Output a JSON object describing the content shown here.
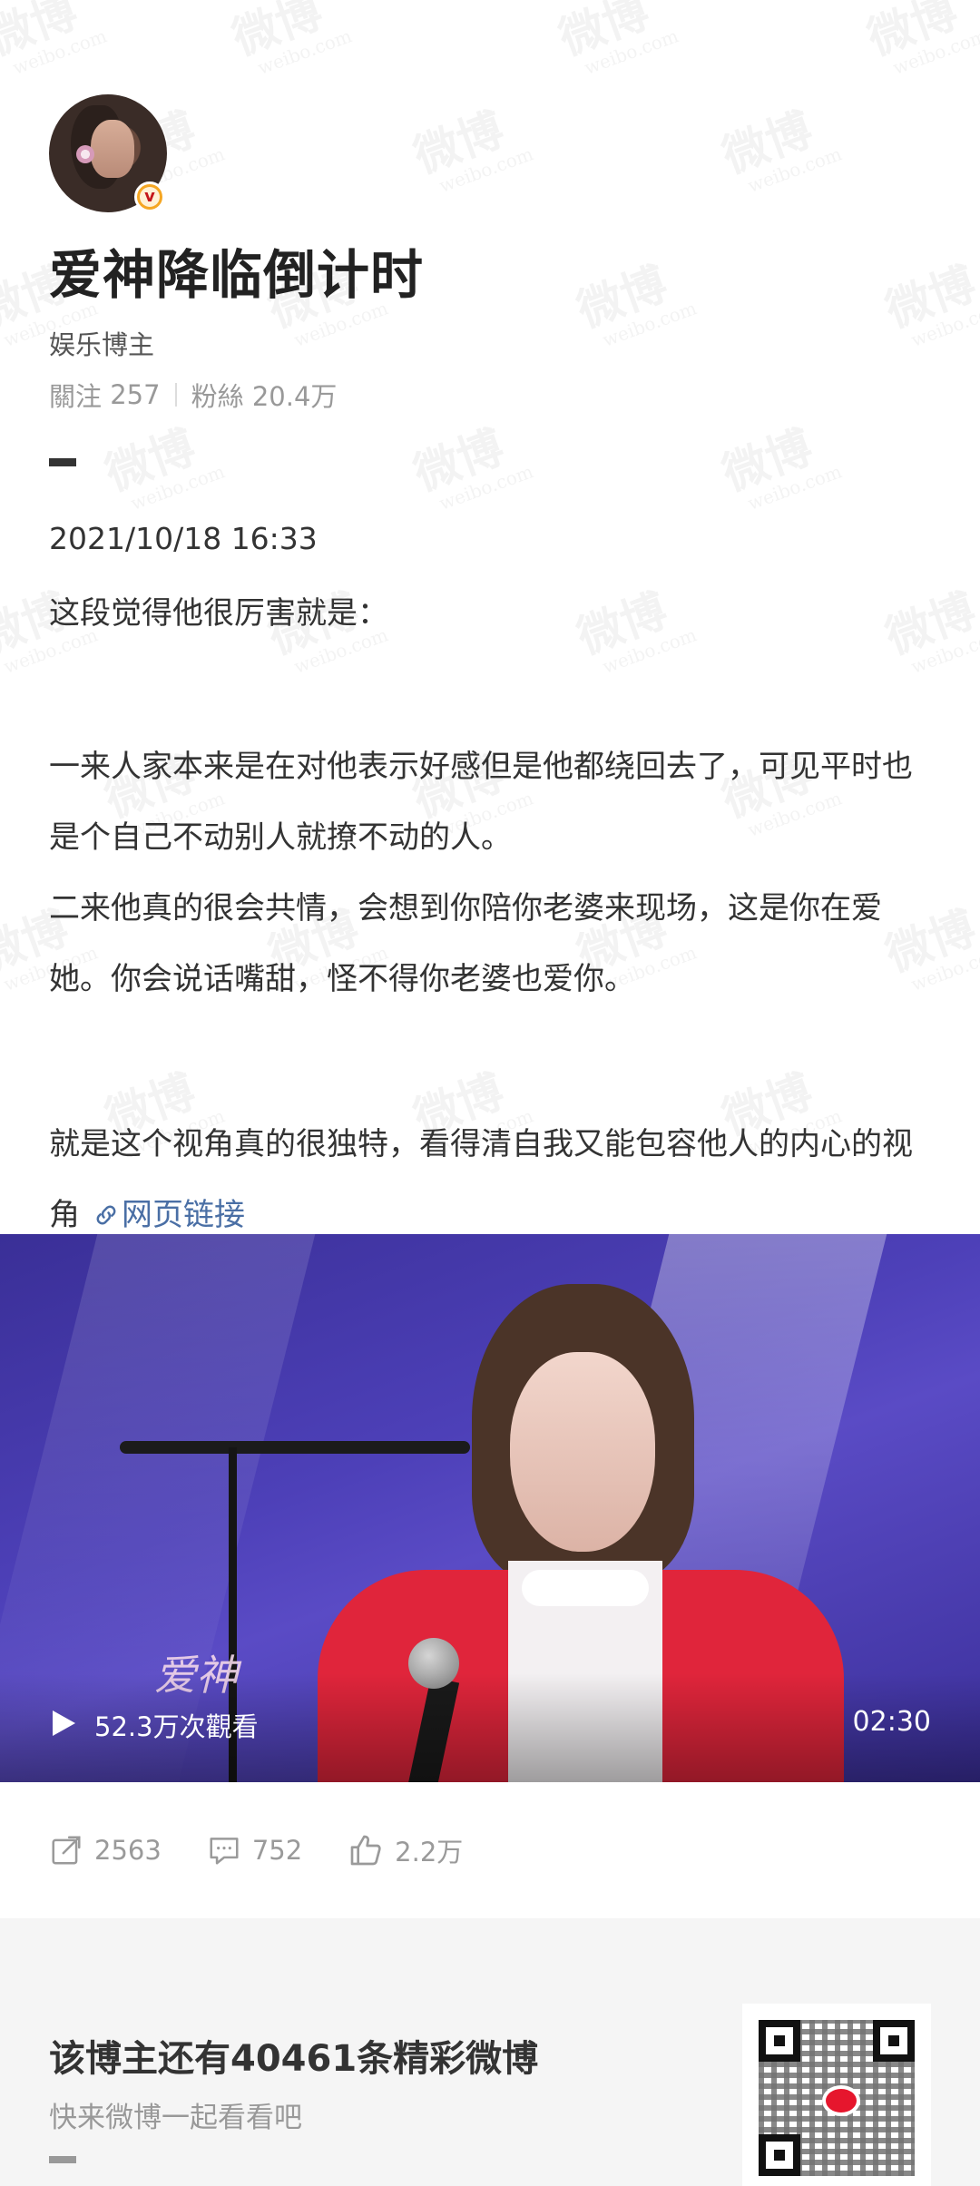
{
  "watermark": {
    "main": "微博",
    "sub": "weibo.com"
  },
  "profile": {
    "name": "爱神降临倒计时",
    "category": "娱乐博主",
    "following_label": "關注",
    "following_count": "257",
    "followers_label": "粉絲",
    "followers_count": "20.4万",
    "verified_badge": "v"
  },
  "post": {
    "date": "2021/10/18 16:33",
    "lines": [
      "这段觉得他很厉害就是：",
      "一来人家本来是在对他表示好感但是他都绕回去了，可见平时也是个自己不动别人就撩不动的人。",
      "二来他真的很会共情，会想到你陪你老婆来现场，这是你在爱她。你会说话嘴甜，怪不得你老婆也爱你。",
      "就是这个视角真的很独特，看得清自我又能包容他人的内心的视角"
    ],
    "link_text": "网页链接"
  },
  "video": {
    "overlay_script": "爱神",
    "views": "52.3万次觀看",
    "duration": "02:30"
  },
  "actions": {
    "reposts": "2563",
    "comments": "752",
    "likes": "2.2万"
  },
  "footer": {
    "title": "该博主还有40461条精彩微博",
    "subtitle": "快来微博一起看看吧"
  },
  "icons": [
    "repost-icon",
    "comment-icon",
    "like-icon",
    "play-icon",
    "link-icon",
    "qr-code",
    "verified-badge-icon"
  ],
  "colors": {
    "link": "#4a6fa5",
    "badge": "#f5a623",
    "video_bg": "#4d40b8",
    "footer_bg": "#f5f5f5"
  }
}
